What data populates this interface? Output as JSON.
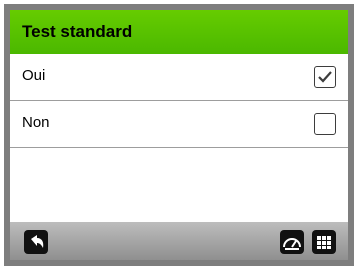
{
  "header": {
    "title": "Test standard"
  },
  "options": [
    {
      "label": "Oui",
      "checked": true
    },
    {
      "label": "Non",
      "checked": false
    }
  ],
  "footer": {
    "left_icon": "back-arrow-icon",
    "right_icons": [
      "speedometer-icon",
      "grid-menu-icon"
    ]
  },
  "colors": {
    "header_bg": "#4bb800",
    "footer_bg": "#9e9e9e",
    "frame": "#7e7e7e"
  }
}
